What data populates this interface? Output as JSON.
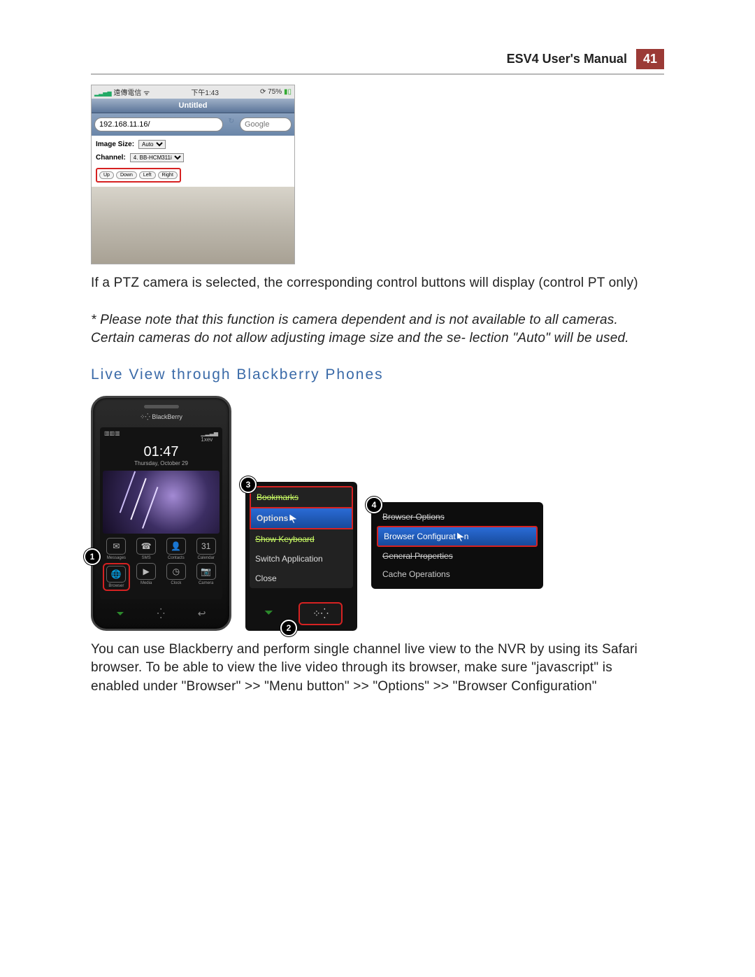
{
  "header": {
    "title": "ESV4 User's Manual",
    "page": "41"
  },
  "iphone": {
    "carrier": "遠傳電信",
    "time": "下午1:43",
    "battery": "75%",
    "tabTitle": "Untitled",
    "url": "192.168.11.16/",
    "searchPlaceholder": "Google",
    "imageSizeLabel": "Image Size:",
    "imageSizeValue": "Auto",
    "channelLabel": "Channel:",
    "channelValue": "4. BB-HCM311i",
    "ptz": {
      "up": "Up",
      "down": "Down",
      "left": "Left",
      "right": "Right"
    }
  },
  "para1": "If a PTZ camera is selected, the corresponding control buttons will display (control PT only)",
  "note": "* Please note that this function is camera dependent and is not available to all cameras. Certain cameras do not allow adjusting image size and the se- lection \"Auto\" will be used.",
  "sectionTitle": "Live View through Blackberry Phones",
  "bbPhone": {
    "brand": "BlackBerry",
    "time": "01:47",
    "date": "Thursday, October 29",
    "icons": [
      {
        "glyph": "✉",
        "label": "Messages"
      },
      {
        "glyph": "☎",
        "label": "SMS"
      },
      {
        "glyph": "👤",
        "label": "Contacts"
      },
      {
        "glyph": "31",
        "label": "Calendar"
      },
      {
        "glyph": "🌐",
        "label": "Browser",
        "hi": true
      },
      {
        "glyph": "▶",
        "label": "Media"
      },
      {
        "glyph": "◷",
        "label": "Clock"
      },
      {
        "glyph": "📷",
        "label": "Camera"
      }
    ]
  },
  "bbMenu": {
    "bookmarks": "Bookmarks",
    "options": "Options",
    "showKeyboard": "Show Keyboard",
    "switchApp": "Switch Application",
    "close": "Close",
    "menuKeyGlyph": "⁘⁛"
  },
  "bbOpts": {
    "browserOptions": "Browser Options",
    "browserConfig": "Browser Configurat",
    "generalProps": "General Properties",
    "cacheOps": "Cache Operations"
  },
  "callouts": {
    "c1": "1",
    "c2": "2",
    "c3": "3",
    "c4": "4"
  },
  "para2": "You can use Blackberry and perform single channel live view to the NVR by using its Safari browser. To be able to view the live video through its browser, make sure \"javascript\" is enabled under \"Browser\" >> \"Menu button\" >> \"Options\" >> \"Browser Configuration\""
}
